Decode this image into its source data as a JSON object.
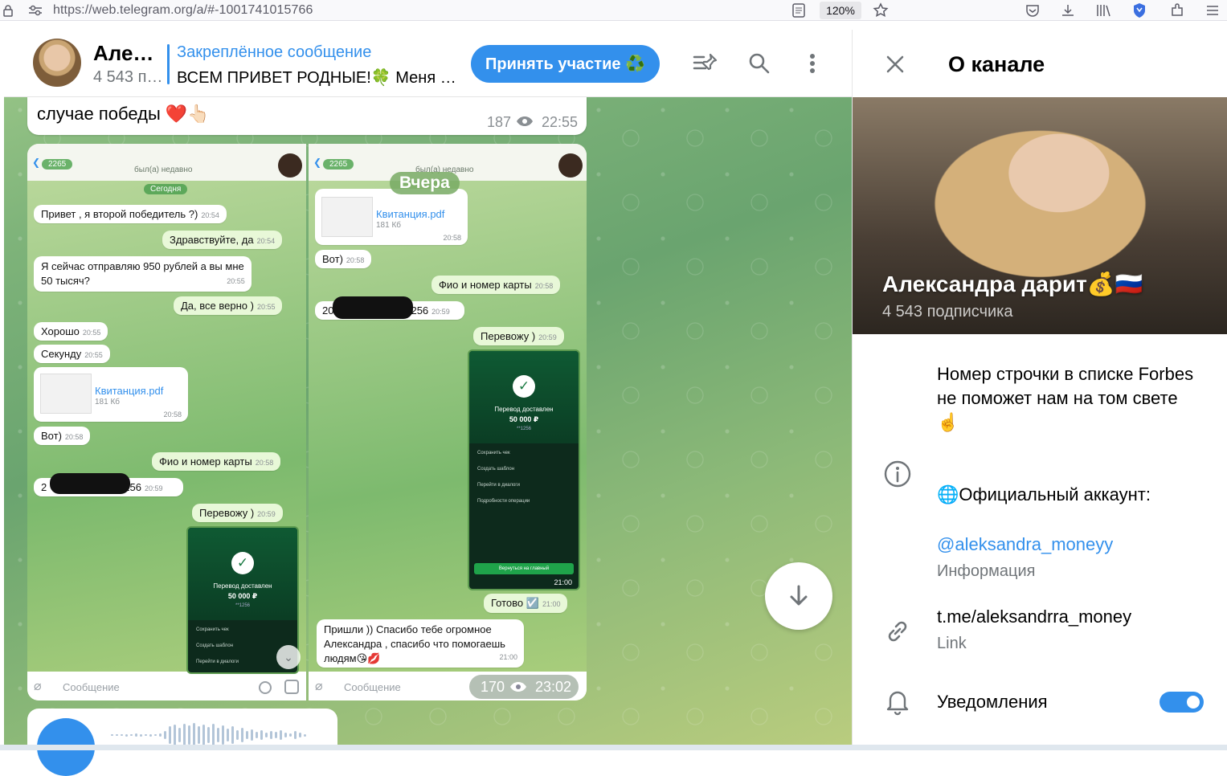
{
  "browser": {
    "url": "https://web.telegram.org/a/#-1001741015766",
    "zoom": "120%"
  },
  "header": {
    "title": "Александра дарит💰🇷🇺",
    "subscribers_short": "4 543 подписчика",
    "pinned_title": "Закреплённое сообщение",
    "pinned_text": "ВСЕМ ПРИВЕТ РОДНЫЕ!🍀 Меня н…",
    "join_label": "Принять участие ♻️"
  },
  "messages": {
    "top_text": "случае победы ❤️👆🏻",
    "top_views": "187",
    "top_time": "22:55",
    "album_views": "170",
    "album_time": "23:02",
    "date_badge": "Вчера"
  },
  "shot_left": {
    "back_count": "2265",
    "status": "был(а) недавно",
    "today": "Сегодня",
    "m1": "Привет , я второй победитель ?)",
    "m1t": "20:54",
    "m2": "Здравствуйте, да",
    "m2t": "20:54",
    "m3a": "Я сейчас отправляю 950 рублей а вы мне",
    "m3b": "50 тысяч?",
    "m3t": "20:55",
    "m4": "Да, все верно )",
    "m4t": "20:55",
    "m5": "Хорошо",
    "m5t": "20:55",
    "m6": "Секунду",
    "m6t": "20:55",
    "file": "Квитанция.pdf",
    "file_size": "181 Кб",
    "file_t": "20:58",
    "m7": "Вот)",
    "m7t": "20:58",
    "m8": "Фио и номер карты",
    "m8t": "20:58",
    "m9a": "2",
    "m9b": "256",
    "m9t": "20:59",
    "m10": "Перевожу )",
    "m10t": "20:59",
    "phone_status": "Перевод доставлен",
    "phone_amount": "50 000 ₽",
    "phone_card": "**1256",
    "phone_r1": "Сохранить чек",
    "phone_r2": "Создать шаблон",
    "phone_r3": "Перейти в диалоги",
    "input_placeholder": "Сообщение"
  },
  "shot_right": {
    "back_count": "2265",
    "status": "был(а) недавно",
    "file": "Квитанция.pdf",
    "file_size": "181 Кб",
    "file_t": "20:58",
    "m1": "Вот)",
    "m1t": "20:58",
    "m2": "Фио и номер карты",
    "m2t": "20:58",
    "m3a": "20",
    "m3b": "256",
    "m3t": "20:59",
    "m4": "Перевожу )",
    "m4t": "20:59",
    "phone_time": "21:00",
    "phone_status": "Перевод доставлен",
    "phone_amount": "50 000 ₽",
    "phone_card": "**1256",
    "phone_r1": "Сохранить чек",
    "phone_r2": "Создать шаблон",
    "phone_r3": "Перейти в диалоги",
    "phone_r4": "Подробности операции",
    "phone_button": "Вернуться на главный",
    "m5": "Готово ☑️",
    "m5t": "21:00",
    "m6a": "Пришли )) Спасибо тебе огромное",
    "m6b": "Александра , спасибо что помогаешь",
    "m6c": "людям😘💋",
    "m6t": "21:00",
    "input_placeholder": "Сообщение"
  },
  "panel": {
    "title": "О канале",
    "name": "Александра дарит💰🇷🇺",
    "subscribers": "4 543 подписчика",
    "description": "Номер строчки в списке Forbes не поможет нам на том свете☝️",
    "official": "🌐Официальный аккаунт:",
    "handle": "@aleksandra_moneyy",
    "info_label": "Информация",
    "link": "t.me/aleksandrra_money",
    "link_label": "Link",
    "notifications": "Уведомления"
  }
}
